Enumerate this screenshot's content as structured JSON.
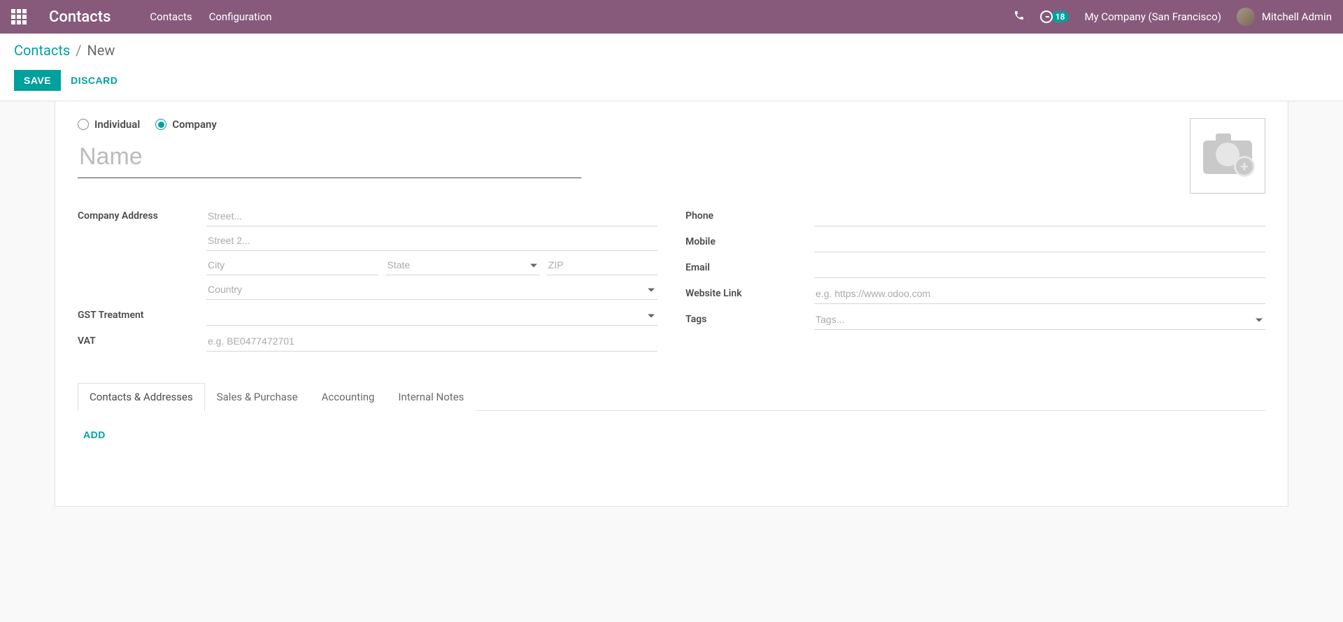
{
  "header": {
    "brand": "Contacts",
    "menu": [
      "Contacts",
      "Configuration"
    ],
    "notif_count": "18",
    "company": "My Company (San Francisco)",
    "user": "Mitchell Admin"
  },
  "breadcrumb": {
    "link": "Contacts",
    "sep": "/",
    "current": "New"
  },
  "actions": {
    "save": "SAVE",
    "discard": "DISCARD"
  },
  "form": {
    "type_individual": "Individual",
    "type_company": "Company",
    "name_placeholder": "Name",
    "labels": {
      "company_address": "Company Address",
      "gst_treatment": "GST Treatment",
      "vat": "VAT",
      "phone": "Phone",
      "mobile": "Mobile",
      "email": "Email",
      "website": "Website Link",
      "tags": "Tags"
    },
    "placeholders": {
      "street": "Street...",
      "street2": "Street 2...",
      "city": "City",
      "state": "State",
      "zip": "ZIP",
      "country": "Country",
      "vat": "e.g. BE0477472701",
      "website": "e.g. https://www.odoo.com",
      "tags": "Tags..."
    }
  },
  "tabs": [
    "Contacts & Addresses",
    "Sales & Purchase",
    "Accounting",
    "Internal Notes"
  ],
  "tab_content": {
    "add": "ADD"
  }
}
